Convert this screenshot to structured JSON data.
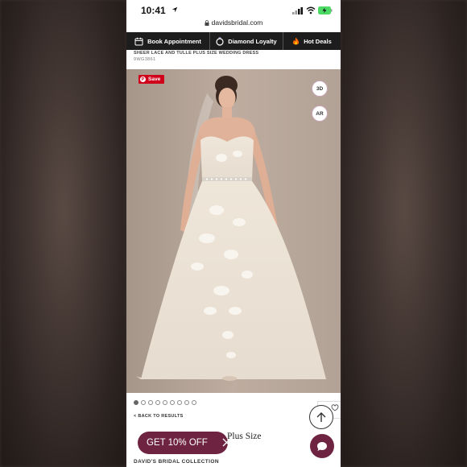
{
  "status_bar": {
    "time": "10:41",
    "url": "davidsbridal.com"
  },
  "nav": {
    "items": [
      {
        "label": "Book Appointment",
        "icon": "calendar-icon"
      },
      {
        "label": "Diamond Loyalty",
        "icon": "ring-icon"
      },
      {
        "label": "Hot Deals",
        "icon": "fire-icon"
      }
    ]
  },
  "product": {
    "name": "SHEER LACE AND TULLE PLUS SIZE WEDDING DRESS",
    "sku": "9WG3861",
    "title_visible": "Plus Size",
    "brand": "DAVID'S BRIDAL COLLECTION"
  },
  "image_actions": {
    "save_label": "Save",
    "btn_3d": "3D",
    "btn_ar": "AR"
  },
  "carousel": {
    "count": 9,
    "active_index": 0
  },
  "back_link": "< BACK TO RESULTS",
  "promo": {
    "label": "GET 10% OFF"
  },
  "colors": {
    "accent": "#6e2440",
    "nav_bg": "#1d1d1d",
    "pinterest_red": "#d0021b"
  }
}
